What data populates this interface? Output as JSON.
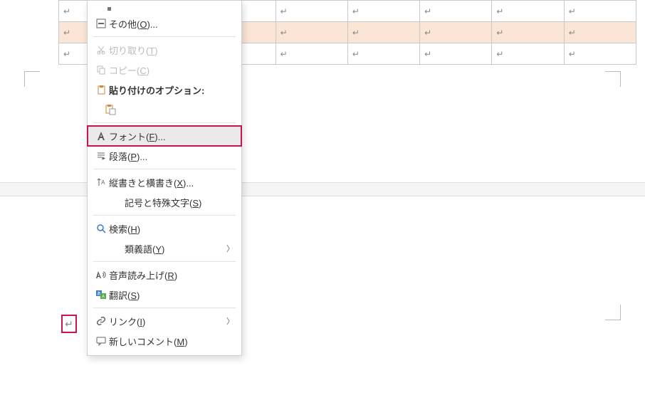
{
  "menu": {
    "more": "その他(O)...",
    "cut": "切り取り(T)",
    "copy": "コピー(C)",
    "paste_hdr": "貼り付けのオプション:",
    "font": "フォント(F)...",
    "paragraph": "段落(P)...",
    "textdir": "縦書きと横書き(X)...",
    "symbols": "記号と特殊文字(S)",
    "find": "検索(H)",
    "thesaurus": "類義語(Y)",
    "readaloud": "音声読み上げ(R)",
    "translate": "翻訳(S)",
    "link": "リンク(I)",
    "newcomment": "新しいコメント(M)"
  },
  "marks": {
    "enter": "↵"
  },
  "table": {
    "rows": 3,
    "cols": 7,
    "selected_row_index": 1
  },
  "colors": {
    "selection_bg": "#fbe5d6",
    "accent_red": "#c9154d"
  }
}
